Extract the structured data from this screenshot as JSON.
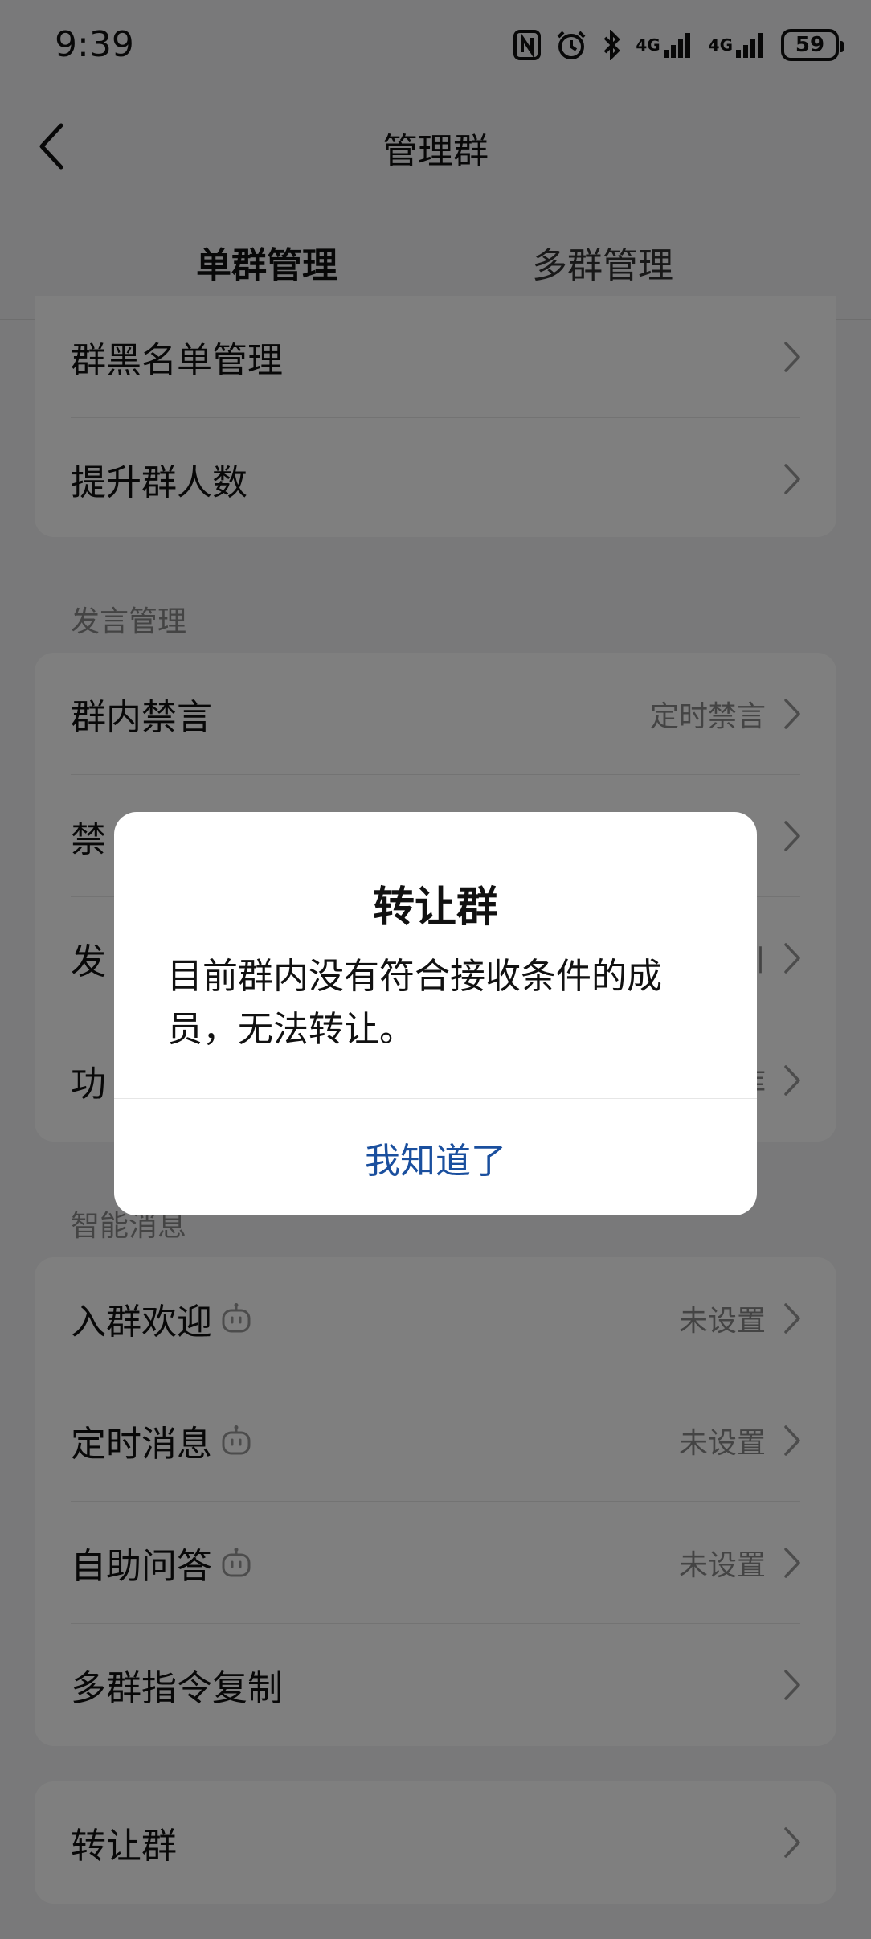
{
  "status": {
    "time": "9:39",
    "battery": "59",
    "net1": "4G",
    "net2": "4G"
  },
  "nav": {
    "title": "管理群"
  },
  "tabs": [
    {
      "label": "单群管理",
      "active": true
    },
    {
      "label": "多群管理",
      "active": false
    }
  ],
  "group_card_1": {
    "rows": [
      {
        "label": "群黑名单管理"
      },
      {
        "label": "提升群人数"
      }
    ]
  },
  "speech_section": {
    "title": "发言管理",
    "rows": [
      {
        "label": "群内禁言",
        "value": "定时禁言"
      },
      {
        "label": "禁",
        "value": ""
      },
      {
        "label": "发",
        "value": "引"
      },
      {
        "label": "功",
        "value": "库"
      }
    ]
  },
  "smart_section": {
    "title": "智能消息",
    "rows": [
      {
        "label": "入群欢迎",
        "value": "未设置"
      },
      {
        "label": "定时消息",
        "value": "未设置"
      },
      {
        "label": "自助问答",
        "value": "未设置"
      },
      {
        "label": "多群指令复制",
        "value": ""
      }
    ]
  },
  "transfer_card": {
    "label": "转让群"
  },
  "dialog": {
    "title": "转让群",
    "message": "目前群内没有符合接收条件的成员，无法转让。",
    "confirm": "我知道了"
  },
  "colors": {
    "accent_tab": "#0b8de6",
    "dialog_button": "#1a4f9e"
  }
}
